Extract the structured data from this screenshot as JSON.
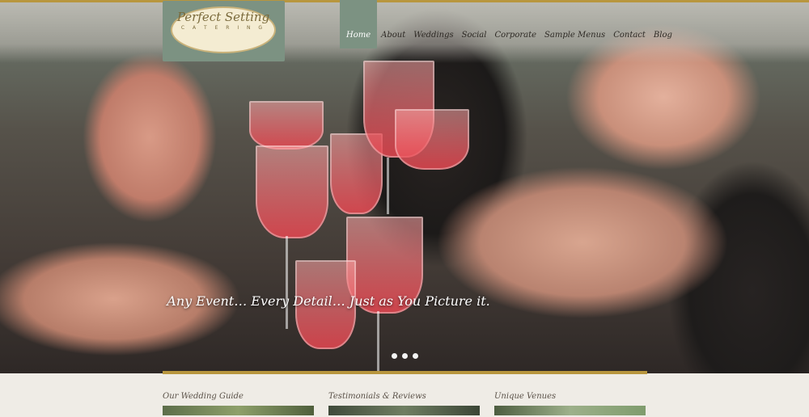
{
  "brand": {
    "name": "Perfect Setting",
    "tagline": "C A T E R I N G"
  },
  "nav": {
    "items": [
      "Home",
      "About",
      "Weddings",
      "Social",
      "Corporate",
      "Sample Menus",
      "Contact",
      "Blog"
    ],
    "active": "Home"
  },
  "hero": {
    "tagline": "Any Event… Every Detail… Just as You Picture it.",
    "slides": 3
  },
  "features": [
    {
      "title": "Our Wedding Guide"
    },
    {
      "title": "Testimonials & Reviews"
    },
    {
      "title": "Unique Venues"
    }
  ],
  "colors": {
    "accent_sage": "#7c9282",
    "accent_gold": "#b8963e",
    "background": "#efece6"
  }
}
